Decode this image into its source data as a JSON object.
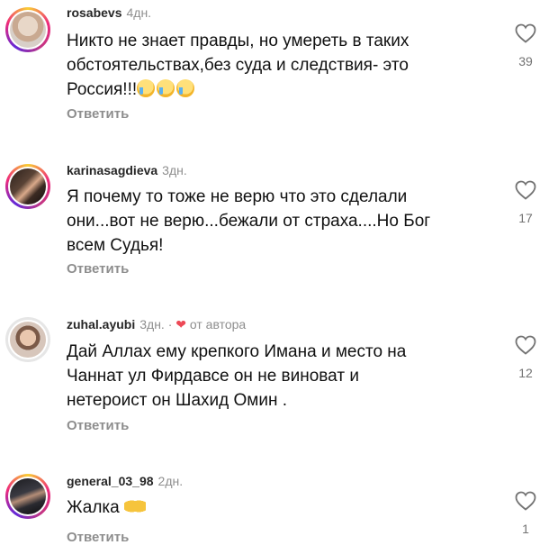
{
  "comments": [
    {
      "username": "rosabevs",
      "time": "4дн.",
      "author_tag": "",
      "lines": [
        "Никто не знает правды, но умереть в таких",
        "обстоятельствах,без суда и следствия- это",
        "Россия!!!"
      ],
      "emojis": [
        "crying-face",
        "crying-face",
        "crying-face"
      ],
      "reply_label": "Ответить",
      "likes": "39"
    },
    {
      "username": "karinasagdieva",
      "time": "3дн.",
      "author_tag": "",
      "lines": [
        "Я почему то тоже не верю что это сделали",
        "они...вот не верю...бежали от страха....Но Бог",
        "всем Судья!"
      ],
      "emojis": [],
      "reply_label": "Ответить",
      "likes": "17"
    },
    {
      "username": "zuhal.ayubi",
      "time": "3дн.",
      "separator": "·",
      "author_tag": "от автора",
      "lines": [
        "Дай Аллах ему крепкого Имана и место на",
        "Чаннат ул Фирдавсе он не виноват и",
        "нетероист он Шахид Омин ."
      ],
      "emojis": [],
      "reply_label": "Ответить",
      "likes": "12"
    },
    {
      "username": "general_03_98",
      "time": "2дн.",
      "author_tag": "",
      "lines": [
        "Жалка"
      ],
      "emojis": [
        "open-hands"
      ],
      "reply_label": "Ответить",
      "likes": "1"
    }
  ],
  "colors": {
    "text": "#111111",
    "muted": "#8e8e8e",
    "heart_red": "#ed4956"
  }
}
